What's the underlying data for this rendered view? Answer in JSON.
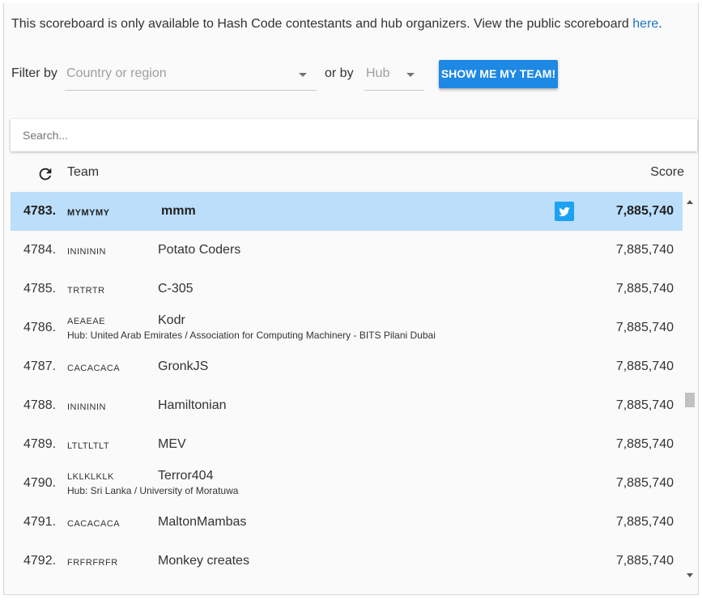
{
  "notice": {
    "text": "This scoreboard is only available to Hash Code contestants and hub organizers. View the public scoreboard ",
    "link": "here",
    "end": "."
  },
  "filters": {
    "filter_by_label": "Filter by",
    "country_placeholder": "Country or region",
    "or_by_label": "or by",
    "hub_placeholder": "Hub",
    "show_team_button": "SHOW ME MY TEAM!"
  },
  "search": {
    "placeholder": "Search..."
  },
  "table": {
    "header_team": "Team",
    "header_score": "Score",
    "rows": [
      {
        "rank": "4783.",
        "code": "MYMYMY",
        "name": "mmm",
        "hub": "",
        "score": "7,885,740",
        "selected": true,
        "twitter": true
      },
      {
        "rank": "4784.",
        "code": "ININININ",
        "name": "Potato Coders",
        "hub": "",
        "score": "7,885,740"
      },
      {
        "rank": "4785.",
        "code": "TRTRTR",
        "name": "C-305",
        "hub": "",
        "score": "7,885,740"
      },
      {
        "rank": "4786.",
        "code": "AEAEAE",
        "name": "Kodr",
        "hub": "Hub: United Arab Emirates / Association for Computing Machinery - BITS Pilani Dubai",
        "score": "7,885,740"
      },
      {
        "rank": "4787.",
        "code": "CACACACA",
        "name": "GronkJS",
        "hub": "",
        "score": "7,885,740"
      },
      {
        "rank": "4788.",
        "code": "ININININ",
        "name": "Hamiltonian",
        "hub": "",
        "score": "7,885,740"
      },
      {
        "rank": "4789.",
        "code": "LTLTLTLT",
        "name": "MEV",
        "hub": "",
        "score": "7,885,740"
      },
      {
        "rank": "4790.",
        "code": "LKLKLKLK",
        "name": "Terror404",
        "hub": "Hub: Sri Lanka / University of Moratuwa",
        "score": "7,885,740"
      },
      {
        "rank": "4791.",
        "code": "CACACACA",
        "name": "MaltonMambas",
        "hub": "",
        "score": "7,885,740"
      },
      {
        "rank": "4792.",
        "code": "FRFRFRFR",
        "name": "Monkey creates",
        "hub": "",
        "score": "7,885,740"
      }
    ]
  },
  "icons": {
    "refresh": "refresh-icon",
    "twitter": "twitter-icon",
    "dropdown": "chevron-down-icon"
  },
  "colors": {
    "accent": "#1e88e5",
    "selected_row": "#bbdefb",
    "link": "#1e73c8",
    "twitter": "#1da1f2"
  }
}
